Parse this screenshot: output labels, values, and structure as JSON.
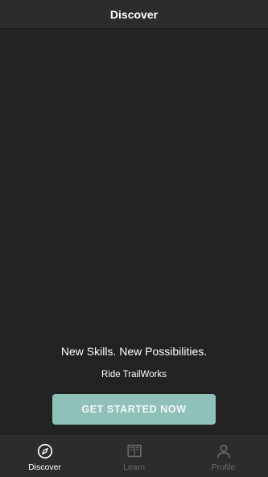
{
  "header": {
    "title": "Discover"
  },
  "hero": {
    "headline": "New Skills. New Possibilities.",
    "subline": "Ride TrailWorks",
    "cta_label": "GET STARTED NOW"
  },
  "tabs": [
    {
      "label": "Discover",
      "icon": "compass-icon",
      "active": true
    },
    {
      "label": "Learn",
      "icon": "book-icon",
      "active": false
    },
    {
      "label": "Profile",
      "icon": "person-icon",
      "active": false
    }
  ],
  "colors": {
    "background": "#222222",
    "bar": "#2c2c2c",
    "accent": "#8fc1b9",
    "inactive": "#6a6a6a"
  }
}
